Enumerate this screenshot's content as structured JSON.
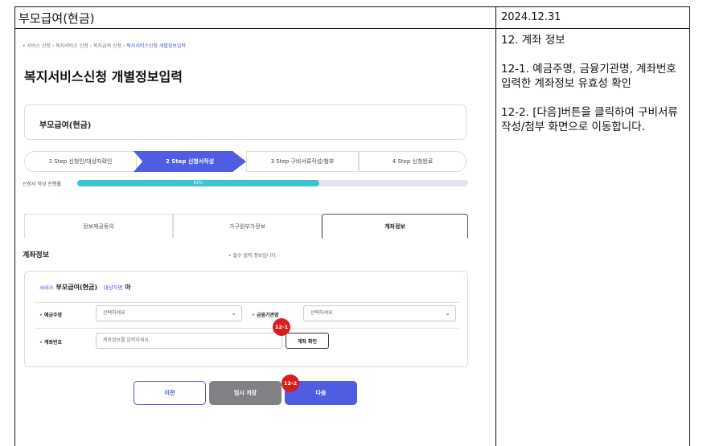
{
  "doc": {
    "title": "부모급여(현금)",
    "date": "2024.12.31",
    "notes": [
      "12. 계좌 정보",
      "12-1. 예금주명, 금융기관명, 계좌번호 입력한 계좌정보 유효성 확인",
      "12-2. [다음]버튼을 클릭하여 구비서류작성/첨부 화면으로 이동합니다."
    ]
  },
  "breadcrumb": [
    "서비스 신청",
    "복지서비스 신청",
    "복지급여 신청",
    "복지서비스신청 개별정보입력"
  ],
  "page_title": "복지서비스신청 개별정보입력",
  "info_card_label": "부모급여(현금)",
  "steps": [
    "1 Step 신청인/대상자확인",
    "2 Step 신청서작성",
    "3 Step 구비서류작성/첨부",
    "4 Step 신청완료"
  ],
  "progress": {
    "label": "신청서 작성 진행률",
    "value_text": "62%",
    "fraction": 0.62
  },
  "tabs": [
    "정보제공동의",
    "가구원부가정보",
    "계좌정보"
  ],
  "section": {
    "title": "계좌정보",
    "required_note": "필수 입력 정보입니다."
  },
  "form": {
    "service_key": "서비스",
    "service_value": "부모급여(현금)",
    "target_key": "대상자명",
    "target_value": "아",
    "account_holder_label": "예금주명",
    "account_holder_value": "선택하세요",
    "bank_label": "금융기관명",
    "bank_value": "선택하세요",
    "account_no_label": "계좌번호",
    "account_no_placeholder": "계좌정보를 입력하세요.",
    "verify_label": "계좌 확인"
  },
  "callouts": [
    "12-1",
    "12-2"
  ],
  "buttons": {
    "prev": "이전",
    "save": "임시 저장",
    "next": "다음"
  },
  "colors": {
    "accent": "#4f5de3",
    "progress": "#3cc3cf",
    "callout": "#d91c1c"
  }
}
